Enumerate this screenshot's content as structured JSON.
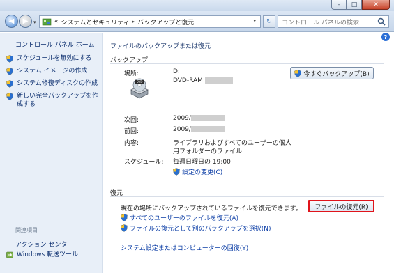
{
  "titlebar": {
    "minimize": "–",
    "maximize": "□",
    "close": "✕"
  },
  "nav": {
    "back": "◀",
    "forward": "▶",
    "dropdown": "▾"
  },
  "address": {
    "overflow": "«",
    "crumbs": [
      "システムとセキュリティ",
      "バックアップと復元"
    ],
    "separator": "▸",
    "dropdown": "▾",
    "refresh": "↻"
  },
  "search": {
    "placeholder": "コントロール パネルの検索"
  },
  "sidebar": {
    "home": "コントロール パネル ホーム",
    "items": [
      {
        "label": "スケジュールを無効にする"
      },
      {
        "label": "システム イメージの作成"
      },
      {
        "label": "システム修復ディスクの作成"
      },
      {
        "label": "新しい完全バックアップを作成する"
      }
    ],
    "related_title": "関連項目",
    "related": [
      {
        "label": "アクション センター"
      },
      {
        "label": "Windows 転送ツール"
      }
    ]
  },
  "main": {
    "help": "?",
    "title": "ファイルのバックアップまたは復元",
    "backup": {
      "heading": "バックアップ",
      "location_label": "場所:",
      "location_value": "D:",
      "drive_name": "DVD-RAM",
      "drive_badge": "DVD",
      "backup_now": "今すぐバックアップ(B)",
      "next_label": "次回:",
      "next_value": "2009/",
      "last_label": "前回:",
      "last_value": "2009/",
      "contents_label": "内容:",
      "contents_line1": "ライブラリおよびすべてのユーザーの個人",
      "contents_line2": "用フォルダーのファイル",
      "schedule_label": "スケジュール:",
      "schedule_value": "毎週日曜日の 19:00",
      "change_settings": "設定の変更(C)"
    },
    "restore": {
      "heading": "復元",
      "description": "現在の場所にバックアップされているファイルを復元できます。",
      "restore_files": "ファイルの復元(R)",
      "restore_all_users": "すべてのユーザーのファイルを復元(A)",
      "select_other": "ファイルの復元として別のバックアップを選択(N)",
      "recover_settings": "システム設定またはコンピューターの回復(Y)"
    }
  },
  "colors": {
    "highlight_border": "#e0141b",
    "link": "#0a3ca5",
    "sidebar_bg": "#e8eff8"
  }
}
